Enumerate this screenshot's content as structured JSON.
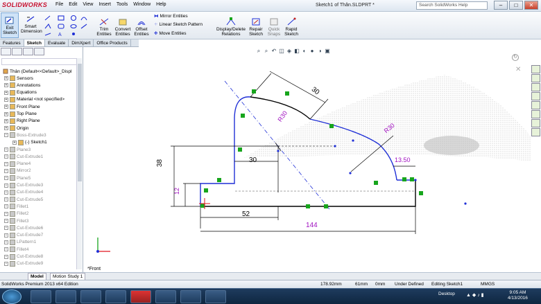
{
  "app": {
    "logo": "SOLIDWORKS",
    "title": "Sketch1 of Thân.SLDPRT *",
    "search_placeholder": "Search SolidWorks Help",
    "menu": [
      "File",
      "Edit",
      "View",
      "Insert",
      "Tools",
      "Window",
      "Help"
    ]
  },
  "ribbon": {
    "exit_sketch": "Exit Sketch",
    "smart_dimension": "Smart Dimension",
    "trim": "Trim Entities",
    "convert": "Convert Entities",
    "offset": "Offset Entities",
    "mirror": "Mirror Entities",
    "linear_pattern": "Linear Sketch Pattern",
    "move": "Move Entities",
    "display_delete": "Display/Delete Relations",
    "repair": "Repair Sketch",
    "quick_snaps": "Quick Snaps",
    "rapid_sketch": "Rapid Sketch"
  },
  "tabs": [
    "Features",
    "Sketch",
    "Evaluate",
    "DimXpert",
    "Office Products"
  ],
  "active_tab": "Sketch",
  "tree": {
    "root": "Thân (Default<<Default>_Displ",
    "items": [
      {
        "label": "Sensors",
        "gray": false,
        "indent": 1
      },
      {
        "label": "Annotations",
        "gray": false,
        "indent": 1
      },
      {
        "label": "Equations",
        "gray": false,
        "indent": 1
      },
      {
        "label": "Material <not specified>",
        "gray": false,
        "indent": 1
      },
      {
        "label": "Front Plane",
        "gray": false,
        "indent": 1
      },
      {
        "label": "Top Plane",
        "gray": false,
        "indent": 1
      },
      {
        "label": "Right Plane",
        "gray": false,
        "indent": 1
      },
      {
        "label": "Origin",
        "gray": false,
        "indent": 1
      },
      {
        "label": "Boss-Extrude3",
        "gray": true,
        "indent": 1
      },
      {
        "label": "(-) Sketch1",
        "gray": false,
        "indent": 2
      },
      {
        "label": "Plane3",
        "gray": true,
        "indent": 1
      },
      {
        "label": "Cut-Extrude1",
        "gray": true,
        "indent": 1
      },
      {
        "label": "Plane4",
        "gray": true,
        "indent": 1
      },
      {
        "label": "Mirror2",
        "gray": true,
        "indent": 1
      },
      {
        "label": "Plane5",
        "gray": true,
        "indent": 1
      },
      {
        "label": "Cut-Extrude3",
        "gray": true,
        "indent": 1
      },
      {
        "label": "Cut-Extrude4",
        "gray": true,
        "indent": 1
      },
      {
        "label": "Cut-Extrude5",
        "gray": true,
        "indent": 1
      },
      {
        "label": "Fillet1",
        "gray": true,
        "indent": 1
      },
      {
        "label": "Fillet2",
        "gray": true,
        "indent": 1
      },
      {
        "label": "Fillet3",
        "gray": true,
        "indent": 1
      },
      {
        "label": "Cut-Extrude6",
        "gray": true,
        "indent": 1
      },
      {
        "label": "Cut-Extrude7",
        "gray": true,
        "indent": 1
      },
      {
        "label": "LPattern1",
        "gray": true,
        "indent": 1
      },
      {
        "label": "Fillet4",
        "gray": true,
        "indent": 1
      },
      {
        "label": "Cut-Extrude8",
        "gray": true,
        "indent": 1
      },
      {
        "label": "Cut-Extrude9",
        "gray": true,
        "indent": 1
      }
    ]
  },
  "sketch": {
    "dim_30_top": "30",
    "dim_r30_left": "R30",
    "dim_r30_right": "R30",
    "dim_38": "38",
    "dim_30_mid": "30",
    "dim_13_50": "13.50",
    "dim_12": "12",
    "dim_52": "52",
    "dim_144": "144",
    "view_label": "*Front"
  },
  "bottom_tabs": [
    "Model",
    "Motion Study 1"
  ],
  "status": {
    "edition": "SolidWorks Premium 2013 x64 Edition",
    "x": "178.92mm",
    "y": "61mm",
    "z": "0mm",
    "state": "Under Defined",
    "editing": "Editing Sketch1",
    "units": "MMGS"
  },
  "taskbar": {
    "desktop": "Desktop",
    "time": "9:05 AM",
    "date": "4/13/2016"
  },
  "colors": {
    "sketch_blue": "#1f2fd6",
    "dimension_black": "#000000",
    "dimension_purple": "#a010c0",
    "relation_green": "#17a51c",
    "origin_red": "#e0141e"
  }
}
